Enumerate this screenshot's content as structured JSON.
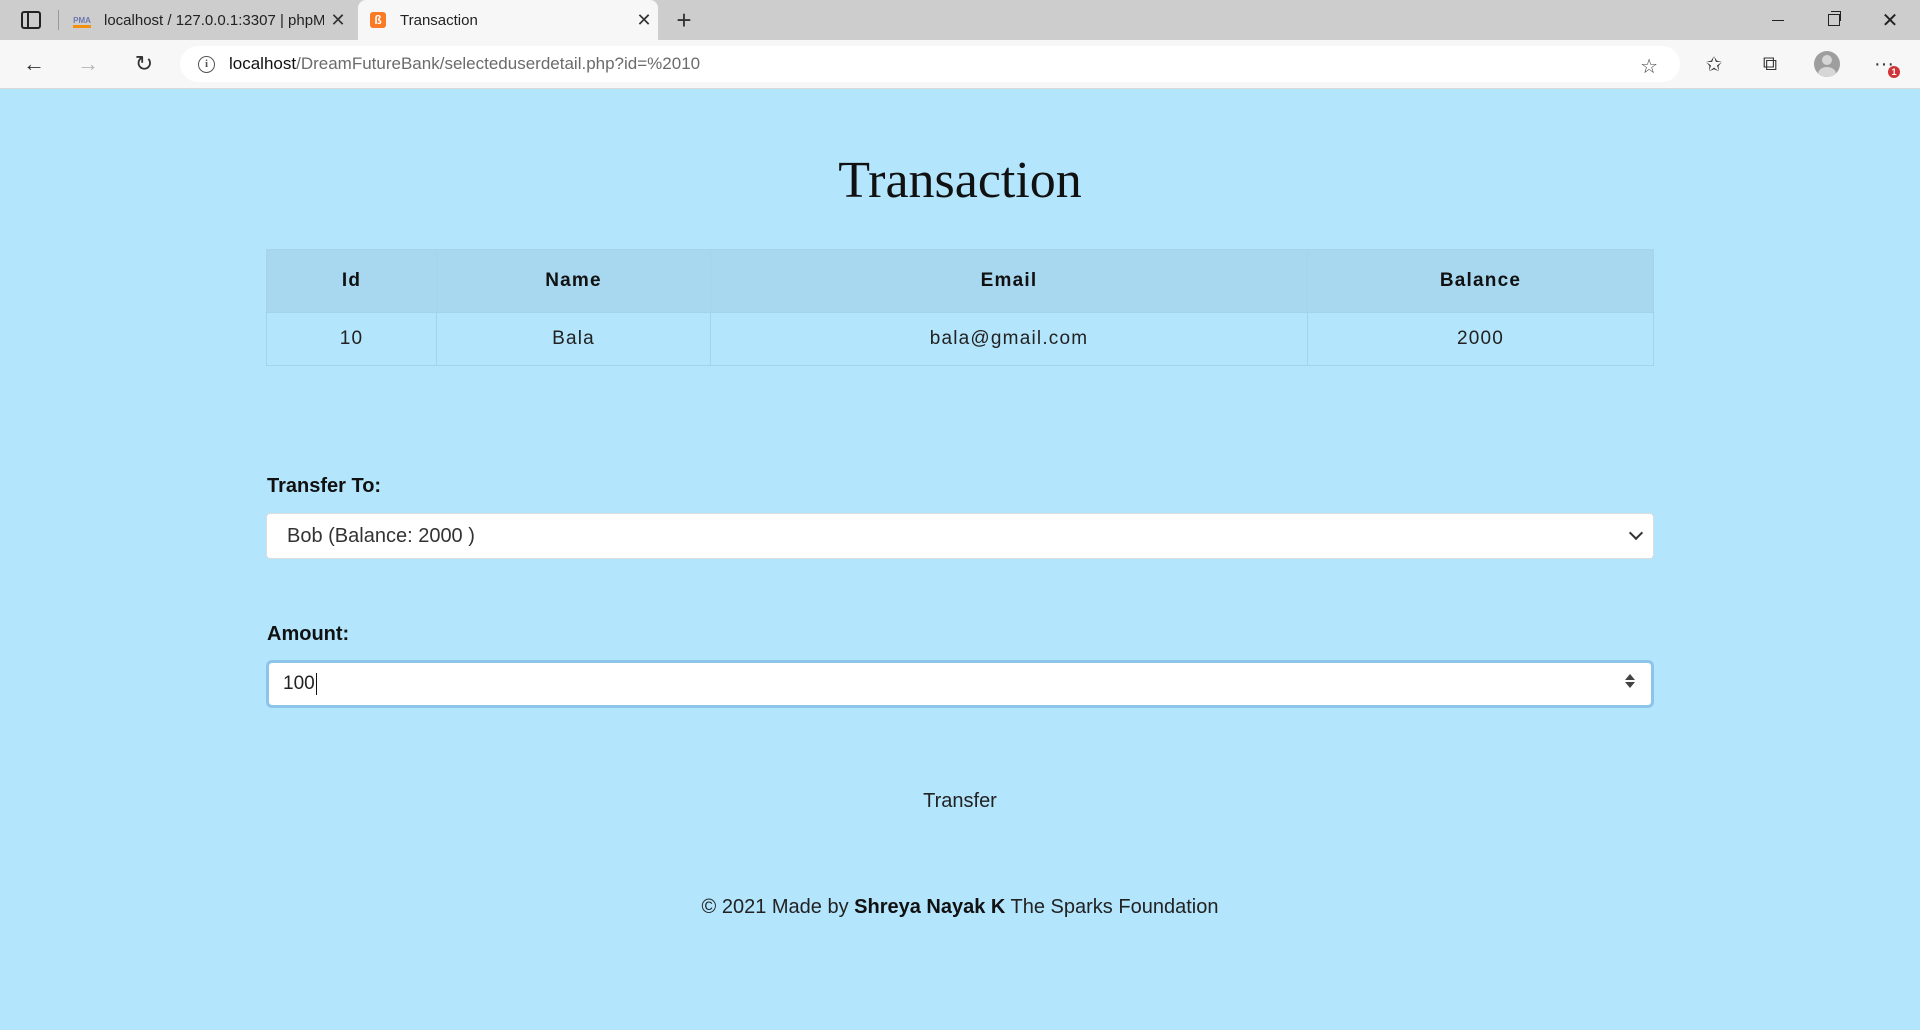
{
  "browser": {
    "tabs": [
      {
        "title": "localhost / 127.0.0.1:3307 | phpM",
        "favicon": "phpmyadmin-icon",
        "active": false
      },
      {
        "title": "Transaction",
        "favicon": "xampp-icon",
        "active": true
      }
    ],
    "url_host": "localhost",
    "url_path": "/DreamFutureBank/selecteduserdetail.php?id=%2010",
    "notification_count": "1"
  },
  "page": {
    "title": "Transaction",
    "table": {
      "headers": [
        "Id",
        "Name",
        "Email",
        "Balance"
      ],
      "rows": [
        [
          "10",
          "Bala",
          "bala@gmail.com",
          "2000"
        ]
      ]
    },
    "transfer_label": "Transfer To:",
    "transfer_selected": "Bob (Balance: 2000 )",
    "amount_label": "Amount:",
    "amount_value": "100",
    "transfer_button": "Transfer",
    "footer": {
      "prefix": "© 2021 Made by ",
      "author": "Shreya Nayak K",
      "suffix": " The Sparks Foundation"
    }
  },
  "colors": {
    "page_background": "#b3e5fc",
    "table_header_background": "#a7d8f0"
  }
}
